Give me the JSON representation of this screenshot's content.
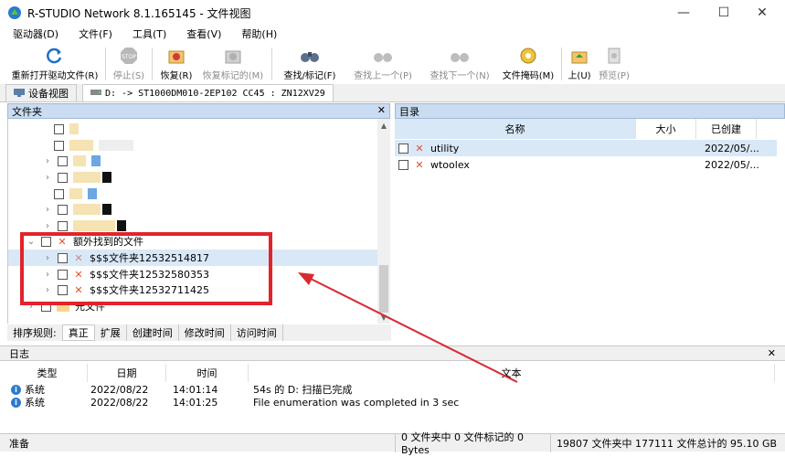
{
  "window": {
    "title": "R-STUDIO Network 8.1.165145 - 文件视图",
    "minimize_glyph": "—",
    "maximize_glyph": "☐",
    "close_glyph": "✕"
  },
  "menu": [
    "驱动器(D)",
    "文件(F)",
    "工具(T)",
    "查看(V)",
    "帮助(H)"
  ],
  "toolbar": [
    {
      "label": "重新打开驱动文件(R)",
      "icon": "refresh-icon",
      "enabled": true
    },
    {
      "label": "停止(S)",
      "icon": "stop-icon",
      "enabled": false
    },
    {
      "label": "恢复(R)",
      "icon": "recover-icon",
      "enabled": true
    },
    {
      "label": "恢复标记的(M)",
      "icon": "recover-marked-icon",
      "enabled": false
    },
    {
      "label": "查找/标记(F)",
      "icon": "binoculars-icon",
      "enabled": true
    },
    {
      "label": "查找上一个(P)",
      "icon": "find-prev-icon",
      "enabled": false
    },
    {
      "label": "查找下一个(N)",
      "icon": "find-next-icon",
      "enabled": false
    },
    {
      "label": "文件掩码(M)",
      "icon": "file-mask-icon",
      "enabled": true
    },
    {
      "label": "上(U)",
      "icon": "folder-up-icon",
      "enabled": true
    },
    {
      "label": "预览(P)",
      "icon": "preview-icon",
      "enabled": false
    }
  ],
  "tabs": [
    {
      "label": "设备视图",
      "active": false
    },
    {
      "label": "D: -> ST1000DM010-2EP102 CC45 : ZN12XV29",
      "active": true
    }
  ],
  "folder_pane": {
    "title": "文件夹",
    "close": "✕",
    "rows": [
      {
        "label": "",
        "indent": 1,
        "expand": "",
        "kind": "folder"
      },
      {
        "label": "",
        "indent": 1,
        "expand": "",
        "kind": "folder"
      },
      {
        "label": "",
        "indent": 1,
        "expand": "›",
        "kind": "folder"
      },
      {
        "label": "",
        "indent": 1,
        "expand": "›",
        "kind": "folder"
      },
      {
        "label": "",
        "indent": 1,
        "expand": "",
        "kind": "folder"
      },
      {
        "label": "",
        "indent": 1,
        "expand": "›",
        "kind": "folder"
      },
      {
        "label": "",
        "indent": 1,
        "expand": "›",
        "kind": "folder"
      },
      {
        "label": "额外找到的文件",
        "indent": 0,
        "expand": "⌄",
        "kind": "xmark"
      },
      {
        "label": "$$$文件夹12532514817",
        "indent": 1,
        "expand": "›",
        "kind": "xmark",
        "selected": true
      },
      {
        "label": "$$$文件夹12532580353",
        "indent": 1,
        "expand": "›",
        "kind": "xmark"
      },
      {
        "label": "$$$文件夹12532711425",
        "indent": 1,
        "expand": "›",
        "kind": "xmark"
      },
      {
        "label": "元文件",
        "indent": 0,
        "expand": "›",
        "kind": "folder"
      }
    ]
  },
  "dir_pane": {
    "title": "目录",
    "columns": [
      "名称",
      "大小",
      "已创建"
    ],
    "rows": [
      {
        "name": "utility",
        "size": "",
        "created": "2022/05/...",
        "selected": true
      },
      {
        "name": "wtoolex",
        "size": "",
        "created": "2022/05/..."
      }
    ]
  },
  "sort_bar": {
    "label": "排序规则:",
    "options": [
      "真正",
      "扩展",
      "创建时间",
      "修改时间",
      "访问时间"
    ],
    "active": 0
  },
  "log": {
    "title": "日志",
    "close": "✕",
    "columns": [
      "类型",
      "日期",
      "时间",
      "文本"
    ],
    "rows": [
      {
        "type": "系统",
        "date": "2022/08/22",
        "time": "14:01:14",
        "text": "54s 的 D: 扫描已完成"
      },
      {
        "type": "系统",
        "date": "2022/08/22",
        "time": "14:01:25",
        "text": "File enumeration was completed in 3 sec"
      }
    ]
  },
  "status": {
    "ready": "准备",
    "marked": "0 文件夹中 0 文件标记的 0 Bytes",
    "total": "19807 文件夹中 177111 文件总计的 95.10 GB"
  },
  "colors": {
    "annotation": "#e2232a",
    "pane_header": "#c9dcf1",
    "selection": "#d9e8f7"
  }
}
